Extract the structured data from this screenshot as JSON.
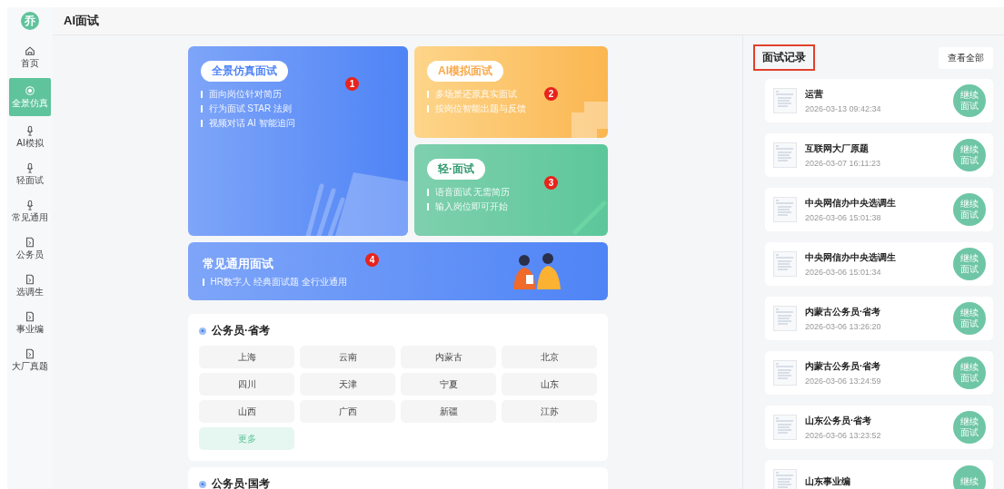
{
  "logo": {
    "text": "乔"
  },
  "sidebar": {
    "items": [
      {
        "label": "首页",
        "kind": "home",
        "selected": false
      },
      {
        "label": "全景仿真",
        "kind": "target",
        "selected": true
      },
      {
        "label": "AI模拟",
        "kind": "mic",
        "selected": false
      },
      {
        "label": "轻面试",
        "kind": "mic",
        "selected": false
      },
      {
        "label": "常见通用",
        "kind": "mic",
        "selected": false
      },
      {
        "label": "公务员",
        "kind": "doc",
        "selected": false
      },
      {
        "label": "选调生",
        "kind": "doc",
        "selected": false
      },
      {
        "label": "事业编",
        "kind": "doc",
        "selected": false
      },
      {
        "label": "大厂真题",
        "kind": "doc",
        "selected": false
      }
    ]
  },
  "header": {
    "title": "AI面试"
  },
  "feature_cards": [
    {
      "kind": "large",
      "title": "全景仿真面试",
      "bullets": [
        "面向岗位针对简历",
        "行为面试 STAR 法则",
        "视频对话 AI 智能追问"
      ],
      "annotation_number": "1"
    },
    {
      "kind": "small",
      "title": "AI模拟面试",
      "bullets": [
        "多场景还原真实面试",
        "按岗位智能出题与反馈"
      ],
      "annotation_number": "2"
    },
    {
      "kind": "small",
      "title": "轻·面试",
      "bullets": [
        "语音面试 无需简历",
        "输入岗位即可开始"
      ],
      "annotation_number": "3"
    },
    {
      "kind": "wide",
      "title": "常见通用面试",
      "bullets": [
        "HR数字人 经典面试题 全行业通用"
      ],
      "annotation_number": "4"
    }
  ],
  "sections": [
    {
      "title": "公务员·省考",
      "options": [
        {
          "label": "上海",
          "kind": "region"
        },
        {
          "label": "云南",
          "kind": "region"
        },
        {
          "label": "内蒙古",
          "kind": "region"
        },
        {
          "label": "北京",
          "kind": "region"
        },
        {
          "label": "四川",
          "kind": "region"
        },
        {
          "label": "天津",
          "kind": "region"
        },
        {
          "label": "宁夏",
          "kind": "region"
        },
        {
          "label": "山东",
          "kind": "region"
        },
        {
          "label": "山西",
          "kind": "region"
        },
        {
          "label": "广西",
          "kind": "region"
        },
        {
          "label": "新疆",
          "kind": "region"
        },
        {
          "label": "江苏",
          "kind": "region"
        },
        {
          "label": "更多",
          "kind": "more"
        }
      ]
    },
    {
      "title": "公务员·国考"
    }
  ],
  "records_panel": {
    "title": "面试记录",
    "view_all": "查看全部",
    "records": [
      {
        "title": "运营",
        "time": "2026-03-13 09:42:34",
        "action": "继续面试"
      },
      {
        "title": "互联网大厂原题",
        "time": "2026-03-07 16:11:23",
        "action": "继续面试"
      },
      {
        "title": "中央网信办中央选调生",
        "time": "2026-03-06 15:01:38",
        "action": "继续面试"
      },
      {
        "title": "中央网信办中央选调生",
        "time": "2026-03-06 15:01:34",
        "action": "继续面试"
      },
      {
        "title": "内蒙古公务员·省考",
        "time": "2026-03-06 13:26:20",
        "action": "继续面试"
      },
      {
        "title": "内蒙古公务员·省考",
        "time": "2026-03-06 13:24:59",
        "action": "继续面试"
      },
      {
        "title": "山东公务员·省考",
        "time": "2026-03-06 13:23:52",
        "action": "继续面试"
      },
      {
        "title": "山东事业编",
        "action": "继续"
      }
    ]
  }
}
